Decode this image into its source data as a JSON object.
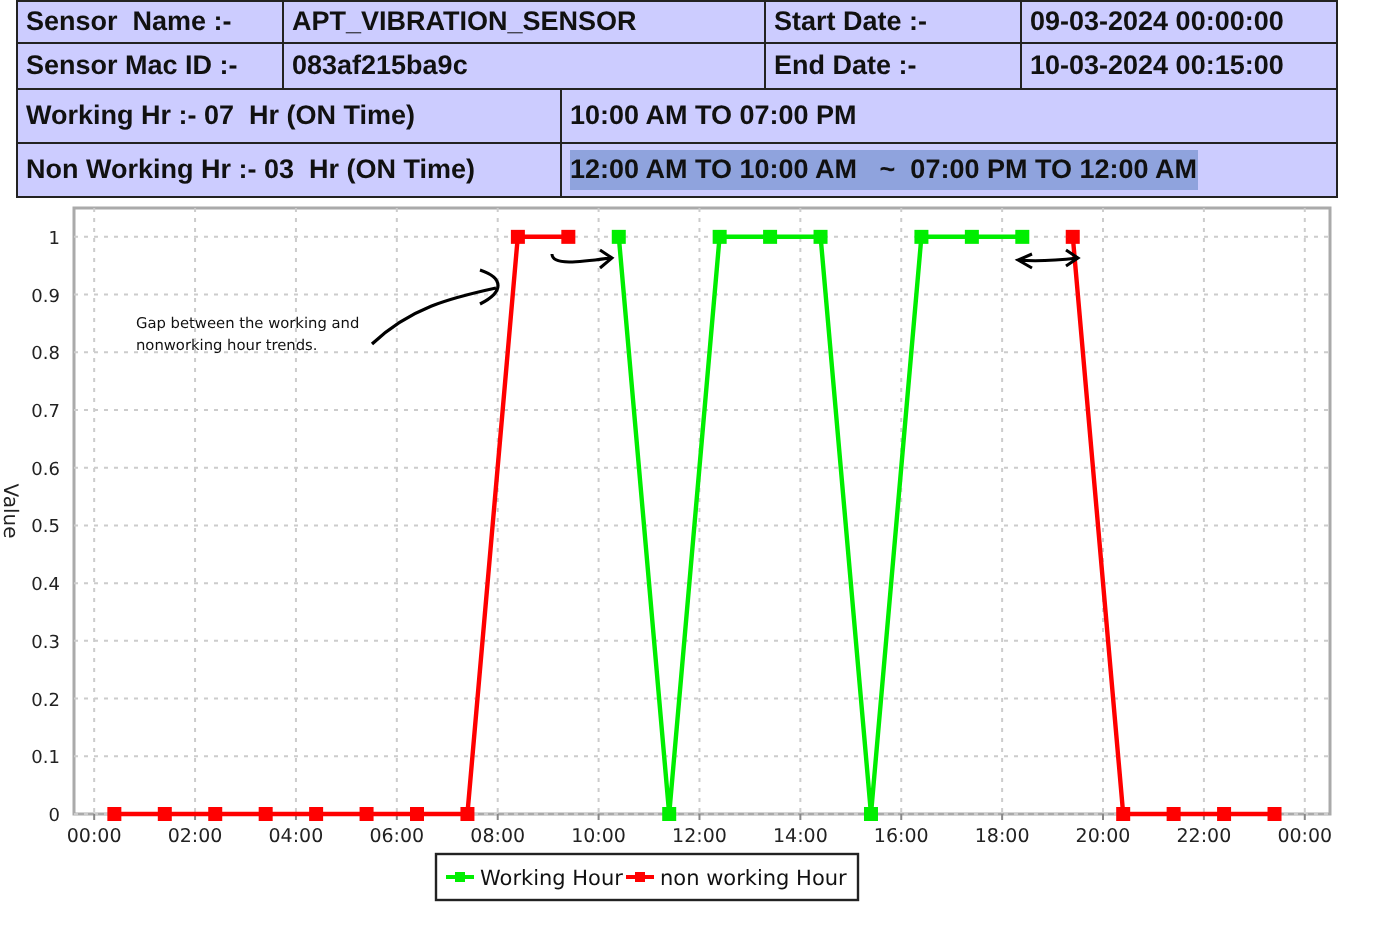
{
  "info_table": {
    "rows": [
      [
        {
          "text": "Sensor  Name :-",
          "selected": false
        },
        {
          "text": "APT_VIBRATION_SENSOR",
          "selected": false
        },
        {
          "text": "Start Date :-",
          "selected": false
        },
        {
          "text": "09-03-2024 00:00:00",
          "selected": false
        }
      ],
      [
        {
          "text": "Sensor Mac ID :-",
          "selected": false
        },
        {
          "text": "083af215ba9c",
          "selected": false
        },
        {
          "text": "End Date :-",
          "selected": false
        },
        {
          "text": "10-03-2024 00:15:00",
          "selected": false
        }
      ],
      [
        {
          "text": "Working Hr :- 07  Hr (ON Time)",
          "selected": false
        },
        {
          "text": "10:00 AM TO 07:00 PM",
          "selected": false
        }
      ],
      [
        {
          "text": "Non Working Hr :- 03  Hr (ON Time)",
          "selected": false
        },
        {
          "text": "12:00 AM TO 10:00 AM   ~  07:00 PM TO 12:00 AM",
          "selected": true
        }
      ]
    ]
  },
  "chart": {
    "chart_data": {
      "type": "line",
      "ylabel": "Value",
      "grid": true,
      "legend": true,
      "x": [
        0.4,
        1.4,
        2.4,
        3.4,
        4.4,
        5.4,
        6.4,
        7.4,
        8.4,
        9.4,
        10.4,
        11.4,
        12.4,
        13.4,
        14.4,
        15.4,
        16.4,
        17.4,
        18.4,
        19.4,
        20.4,
        21.4,
        22.4,
        23.4
      ],
      "series": [
        {
          "name": "Working Hour",
          "color": "#00ee00",
          "marker": "square",
          "values": [
            null,
            null,
            null,
            null,
            null,
            null,
            null,
            null,
            null,
            null,
            1,
            0,
            1,
            1,
            1,
            0,
            1,
            1,
            1,
            null,
            null,
            null,
            null,
            null
          ]
        },
        {
          "name": "non working Hour",
          "color": "#ff0000",
          "marker": "square",
          "values": [
            0,
            0,
            0,
            0,
            0,
            0,
            0,
            0,
            1,
            1,
            null,
            null,
            null,
            null,
            null,
            null,
            null,
            null,
            null,
            1,
            0,
            0,
            0,
            0
          ]
        }
      ],
      "xlim": [
        -0.4,
        24.5
      ],
      "ylim": [
        0,
        1.05
      ],
      "xticks": [
        {
          "value": 0,
          "label": "00:00"
        },
        {
          "value": 2,
          "label": "02:00"
        },
        {
          "value": 4,
          "label": "04:00"
        },
        {
          "value": 6,
          "label": "06:00"
        },
        {
          "value": 8,
          "label": "08:00"
        },
        {
          "value": 10,
          "label": "10:00"
        },
        {
          "value": 12,
          "label": "12:00"
        },
        {
          "value": 14,
          "label": "14:00"
        },
        {
          "value": 16,
          "label": "16:00"
        },
        {
          "value": 18,
          "label": "18:00"
        },
        {
          "value": 20,
          "label": "20:00"
        },
        {
          "value": 22,
          "label": "22:00"
        },
        {
          "value": 24,
          "label": "00:00"
        }
      ],
      "yticks": [
        0,
        0.1,
        0.2,
        0.3,
        0.4,
        0.5,
        0.6,
        0.7,
        0.8,
        0.9,
        1
      ],
      "annotations": [
        {
          "text": "Gap between the working and nonworking hour trends."
        }
      ]
    }
  }
}
